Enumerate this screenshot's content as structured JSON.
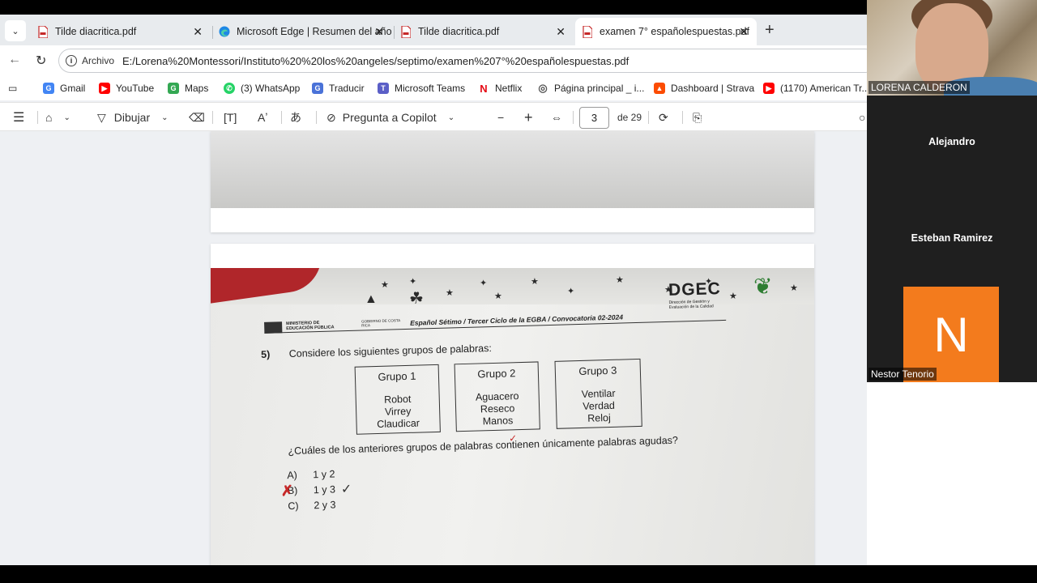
{
  "tabs": [
    {
      "title": "Tilde diacritica.pdf",
      "icon": "pdf-icon"
    },
    {
      "title": "Microsoft Edge | Resumen del año",
      "icon": "edge-icon"
    },
    {
      "title": "Tilde diacritica.pdf",
      "icon": "pdf-icon"
    },
    {
      "title": "examen 7° españolespuestas.pdf",
      "icon": "pdf-icon",
      "active": true
    }
  ],
  "address": {
    "label": "Archivo",
    "url": "E:/Lorena%20Montessori/Instituto%20%20los%20angeles/septimo/examen%207°%20españolespuestas.pdf"
  },
  "favorites": [
    {
      "label": "Gmail",
      "color": "#4285f4",
      "glyph": "G"
    },
    {
      "label": "YouTube",
      "color": "#ff0000",
      "glyph": "▶"
    },
    {
      "label": "Maps",
      "color": "#34a853",
      "glyph": "G"
    },
    {
      "label": "(3) WhatsApp",
      "color": "#25d366",
      "glyph": "✆"
    },
    {
      "label": "Traducir",
      "color": "#4a72d8",
      "glyph": "G"
    },
    {
      "label": "Microsoft Teams",
      "color": "#5b5fc7",
      "glyph": "T"
    },
    {
      "label": "Netflix",
      "color": "#e50914",
      "glyph": "N"
    },
    {
      "label": "Página principal _ i...",
      "color": "#666666",
      "glyph": "◎"
    },
    {
      "label": "Dashboard | Strava",
      "color": "#fc4c02",
      "glyph": "▲"
    },
    {
      "label": "(1170) American Tr...",
      "color": "#ff0000",
      "glyph": "▶"
    }
  ],
  "pdf_toolbar": {
    "draw_label": "Dibujar",
    "copilot_label": "Pregunta a Copilot",
    "page_number": "3",
    "page_total": "de 29"
  },
  "document": {
    "brand": "DGEC",
    "brand_sub": "Dirección de Gestión y Evaluación de la Calidad",
    "ministry": "MINISTERIO DE EDUCACIÓN PÚBLICA",
    "gov": "GOBIERNO DE COSTA RICA",
    "header_text": "Español Sétimo / Tercer Ciclo de la EGBA / Convocatoria 02-2024",
    "q_number": "5)",
    "q_intro": "Considere los siguientes grupos de palabras:",
    "groups": [
      {
        "title": "Grupo 1",
        "words": [
          "Robot",
          "Virrey",
          "Claudicar"
        ]
      },
      {
        "title": "Grupo 2",
        "words": [
          "Aguacero",
          "Reseco",
          "Manos"
        ]
      },
      {
        "title": "Grupo 3",
        "words": [
          "Ventilar",
          "Verdad",
          "Reloj"
        ]
      }
    ],
    "question": "¿Cuáles de los anteriores grupos de palabras contienen únicamente palabras agudas?",
    "options": [
      {
        "letter": "A)",
        "text": "1 y 2"
      },
      {
        "letter": "B)",
        "text": "1 y 3"
      },
      {
        "letter": "C)",
        "text": "2 y 3"
      }
    ]
  },
  "participants": {
    "main": "LORENA CALDERON",
    "p2": "Alejandro",
    "p3": "Esteban Ramirez",
    "p4": "Nestor Tenorio",
    "p4_initial": "N"
  }
}
